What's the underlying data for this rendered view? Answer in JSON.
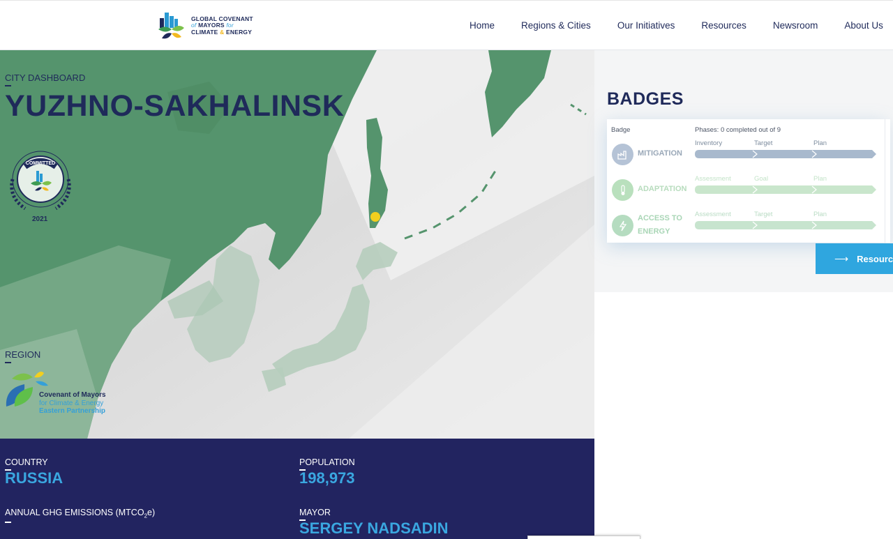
{
  "header": {
    "logo": {
      "line1": "GLOBAL COVENANT",
      "line2a": "of",
      "line2b": "MAYORS",
      "line2c": "for",
      "line3a": "CLIMATE",
      "line3b": "&",
      "line3c": "ENERGY"
    },
    "nav": [
      "Home",
      "Regions & Cities",
      "Our Initiatives",
      "Resources",
      "Newsroom",
      "About Us"
    ]
  },
  "hero": {
    "dashboard_label": "CITY DASHBOARD",
    "city_name": "YUZHNO-SAKHALINSK",
    "committed_badge": {
      "ring_text": "COMMITTED",
      "year": "2021"
    },
    "region_label": "REGION",
    "region_logo": {
      "line1": "Covenant of Mayors",
      "line2": "for Climate & Energy",
      "line3": "Eastern Partnership"
    }
  },
  "info": {
    "country_label": "COUNTRY",
    "country": "RUSSIA",
    "population_label": "POPULATION",
    "population": "198,973",
    "emissions_label_main": "ANNUAL GHG EMISSIONS (MTCO",
    "emissions_label_sub": "2",
    "emissions_label_end": "e)",
    "mayor_label": "MAYOR",
    "mayor": "SERGEY NADSADIN"
  },
  "badges": {
    "title": "BADGES",
    "col_badge": "Badge",
    "phases": "Phases: 0 completed out of 9",
    "rows": [
      {
        "name": "MITIGATION",
        "phases": [
          "Inventory",
          "Target",
          "Plan"
        ],
        "icon": "factory-icon"
      },
      {
        "name": "ADAPTATION",
        "phases": [
          "Assessment",
          "Goal",
          "Plan"
        ],
        "icon": "thermometer-icon"
      },
      {
        "name": "ACCESS TO ENERGY",
        "name_l1": "ACCESS TO",
        "name_l2": "ENERGY",
        "phases": [
          "Assessment",
          "Target",
          "Plan"
        ],
        "icon": "lightning-icon"
      }
    ],
    "colors": {
      "mitigation": "#a8b9cd",
      "adaptation": "#c9e6cc",
      "access": "#c7e4ce",
      "mitigation_icon": "#b5c3d6",
      "adaptation_icon": "#b9e0bd",
      "access_icon": "#b5dcc0"
    }
  },
  "resources_button": "Resources",
  "colors": {
    "navy": "#222460",
    "accent": "#3aa7e0",
    "land": "#4e8f6a"
  }
}
